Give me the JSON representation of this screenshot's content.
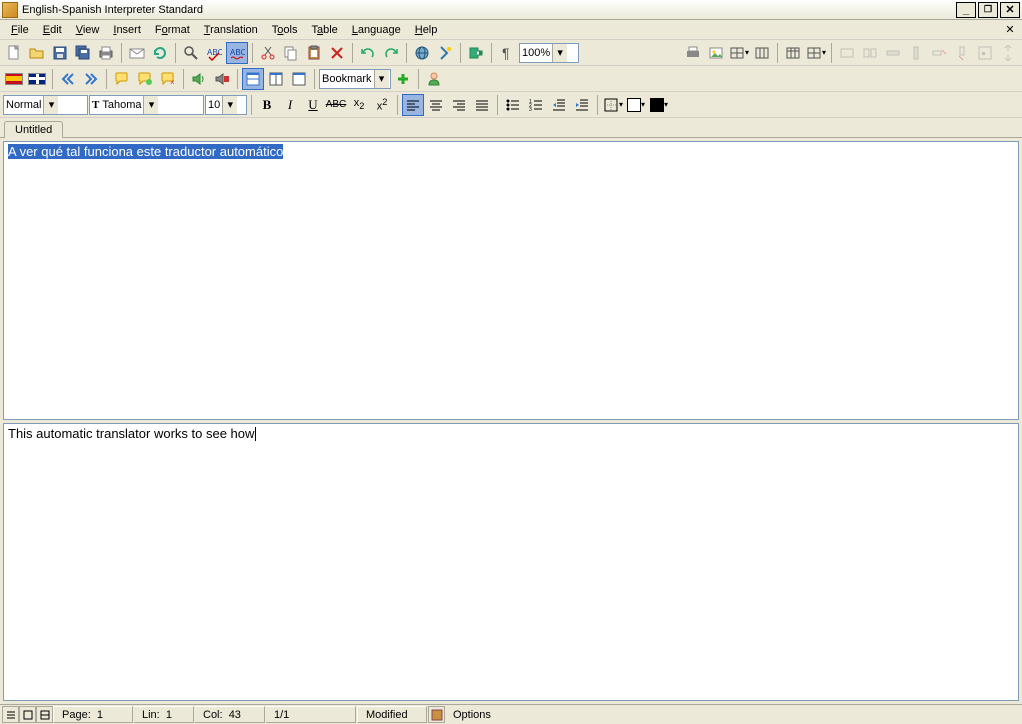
{
  "window": {
    "title": "English-Spanish Interpreter Standard"
  },
  "menu": {
    "file": "File",
    "edit": "Edit",
    "view": "View",
    "insert": "Insert",
    "format": "Format",
    "translation": "Translation",
    "tools": "Tools",
    "table": "Table",
    "language": "Language",
    "help": "Help"
  },
  "toolbar": {
    "zoom": "100%",
    "bookmark": "Bookmark"
  },
  "format": {
    "style": "Normal",
    "font": "Tahoma",
    "size": "10"
  },
  "tab": {
    "label": "Untitled"
  },
  "editor": {
    "source": "A ver qué tal funciona este traductor automático",
    "target": "This automatic translator works to see how"
  },
  "status": {
    "page_label": "Page:",
    "page": "1",
    "lin_label": "Lin:",
    "lin": "1",
    "col_label": "Col:",
    "col": "43",
    "pages": "1/1",
    "modified": "Modified",
    "options": "Options"
  }
}
